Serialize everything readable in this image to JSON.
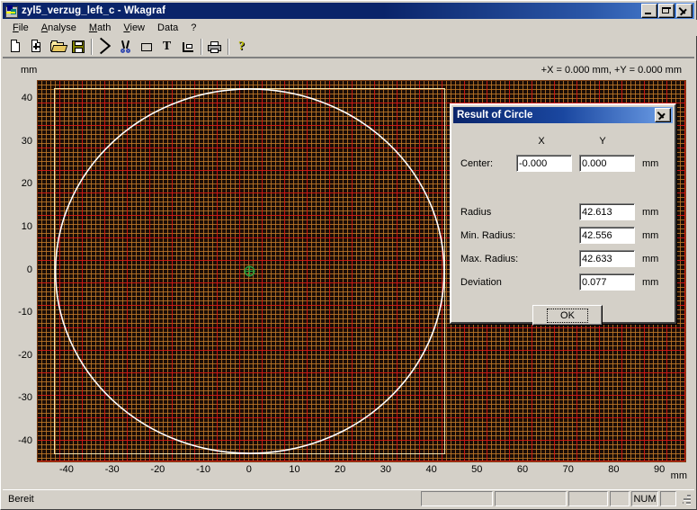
{
  "window": {
    "title": "zyl5_verzug_left_c - Wkagraf",
    "icon": "app-graph-icon",
    "buttons": {
      "minimize": "Minimize",
      "maximize": "Maximize",
      "close": "Close"
    }
  },
  "menubar": {
    "items": [
      {
        "label": "File",
        "accel": "F"
      },
      {
        "label": "Analyse",
        "accel": "A"
      },
      {
        "label": "Math",
        "accel": "M"
      },
      {
        "label": "View",
        "accel": "V"
      },
      {
        "label": "Data",
        "accel": ""
      },
      {
        "label": "?",
        "accel": ""
      }
    ]
  },
  "toolbar": {
    "items": [
      {
        "name": "new-document-icon",
        "tip": "New"
      },
      {
        "name": "add-document-icon",
        "tip": "Add"
      },
      {
        "name": "open-folder-icon",
        "tip": "Open"
      },
      {
        "name": "save-disk-icon",
        "tip": "Save"
      },
      {
        "name": "separator",
        "tip": ""
      },
      {
        "name": "delete-cross-icon",
        "tip": "Delete"
      },
      {
        "name": "scissors-cut-icon",
        "tip": "Cut"
      },
      {
        "name": "rectangle-icon",
        "tip": "Rectangle"
      },
      {
        "name": "text-tool-icon",
        "tip": "Text"
      },
      {
        "name": "axis-corner-icon",
        "tip": "Axis"
      },
      {
        "name": "separator",
        "tip": ""
      },
      {
        "name": "print-icon",
        "tip": "Print"
      },
      {
        "name": "separator",
        "tip": ""
      },
      {
        "name": "help-question-icon",
        "tip": "Help"
      }
    ]
  },
  "chart_data": {
    "type": "scatter",
    "title": "",
    "xlabel": "mm",
    "ylabel": "mm",
    "unit_top_left": "mm",
    "unit_bottom_right": "mm",
    "coordinate_readout": "+X = 0.000 mm, +Y = 0.000 mm",
    "xlim": [
      -46.5,
      95.5
    ],
    "ylim": [
      -44.5,
      44.5
    ],
    "xticks": [
      -40,
      -30,
      -20,
      -10,
      0,
      10,
      20,
      30,
      40,
      50,
      60,
      70,
      80,
      90
    ],
    "yticks": [
      40,
      30,
      20,
      10,
      0,
      -10,
      -20,
      -30,
      -40
    ],
    "xtick_labels": [
      "-40",
      "-30",
      "-20",
      "-10",
      "0",
      "10",
      "20",
      "30",
      "40",
      "50",
      "60",
      "70",
      "80",
      "90"
    ],
    "ytick_labels": [
      "40",
      "30",
      "20",
      "10",
      "0",
      "-10",
      "-20",
      "-30",
      "-40"
    ],
    "grid": true,
    "grid_minor_spacing_mm": 1,
    "grid_major_spacing_mm": 5,
    "background_color": "#1a0d07",
    "grid_minor_color": "#b87828",
    "grid_major_color": "#cd1414",
    "series": [
      {
        "name": "measured-circle",
        "type": "circle",
        "color": "#ffffff",
        "center_x": 0.0,
        "center_y": 0.0,
        "radius": 42.613
      },
      {
        "name": "center-marker",
        "type": "marker",
        "color": "#1f9f3f",
        "x": 0.0,
        "y": 0.0
      },
      {
        "name": "bounding-box",
        "type": "rect",
        "color": "#f0e4b0",
        "x0": -42.9,
        "y0": -42.9,
        "x1": 42.9,
        "y1": 42.9
      }
    ]
  },
  "dialog": {
    "title": "Result of Circle",
    "close_label": "Close",
    "columns": {
      "x": "X",
      "y": "Y"
    },
    "rows": [
      {
        "label": "Center:",
        "value_x": "-0.000",
        "value_y": "0.000",
        "unit": "mm"
      },
      {
        "label": "Radius",
        "value": "42.613",
        "unit": "mm"
      },
      {
        "label": "Min. Radius:",
        "value": "42.556",
        "unit": "mm"
      },
      {
        "label": "Max. Radius:",
        "value": "42.633",
        "unit": "mm"
      },
      {
        "label": "Deviation",
        "value": "0.077",
        "unit": "mm"
      }
    ],
    "ok_label": "OK"
  },
  "statusbar": {
    "message": "Bereit",
    "panels": [
      "",
      "",
      "",
      "",
      "NUM",
      ""
    ]
  }
}
